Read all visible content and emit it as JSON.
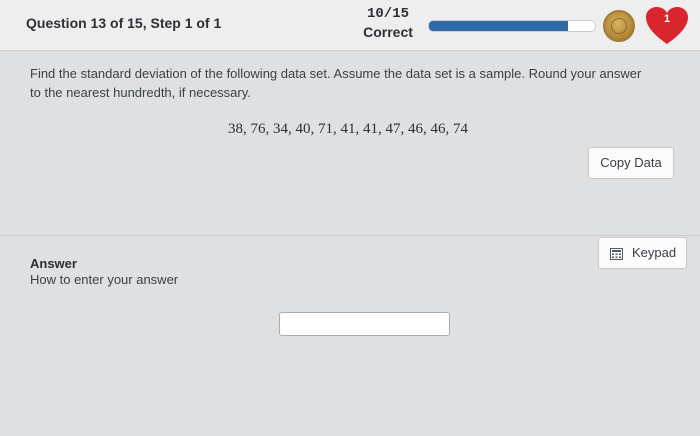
{
  "header": {
    "question_title": "Question 13 of 15, Step 1 of 1",
    "score_fraction": "10/15",
    "score_label": "Correct",
    "progress_fraction": 0.84,
    "lives_count": "1",
    "colors": {
      "progress": "#2f6aa6",
      "heart": "#d8262f",
      "coin": "#b58a39"
    }
  },
  "question": {
    "prompt": "Find the standard deviation of the following data set. Assume the data set is a sample. Round your answer to the nearest hundredth, if necessary.",
    "dataset": "38, 76, 34, 40, 71, 41, 41, 47, 46, 46, 74",
    "copy_label": "Copy Data"
  },
  "answer": {
    "title": "Answer",
    "help_link": "How to enter your answer",
    "keypad_label": "Keypad",
    "input_value": ""
  }
}
